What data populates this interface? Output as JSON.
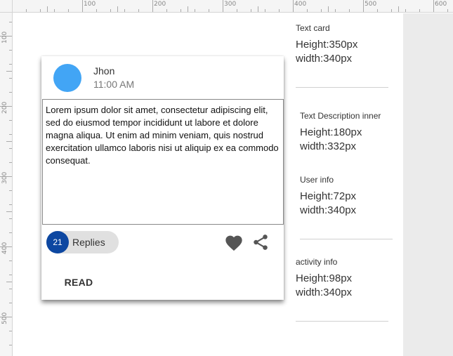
{
  "ruler": {
    "top_labels": [
      "100",
      "200",
      "300",
      "400",
      "500",
      "600"
    ],
    "left_labels": [
      "100",
      "200",
      "300",
      "400",
      "500"
    ]
  },
  "card": {
    "user": {
      "name": "Jhon",
      "time": "11:00 AM"
    },
    "description": "Lorem ipsum dolor sit amet, consectetur adipiscing elit, sed do eiusmod tempor incididunt ut labore et dolore magna aliqua. Ut enim ad minim veniam, quis nostrud exercitation ullamco laboris nisi ut aliquip ex ea commodo consequat.",
    "replies": {
      "count": "21",
      "label": "Replies"
    },
    "read_label": "READ"
  },
  "annotations": [
    {
      "title": "Text card",
      "height": "Height:350px",
      "width": "width:340px"
    },
    {
      "title": "Text Description inner",
      "height": "Height:180px",
      "width": "width:332px"
    },
    {
      "title": "User info",
      "height": "Height:72px",
      "width": "width:340px"
    },
    {
      "title": "activity info",
      "height": "Height:98px",
      "width": "width:340px"
    }
  ],
  "colors": {
    "avatar": "#42a5f5",
    "replies_badge": "#0d47a1",
    "pill": "#e0e0e0",
    "icon": "#555555"
  },
  "icons": [
    "heart-icon",
    "share-icon"
  ]
}
